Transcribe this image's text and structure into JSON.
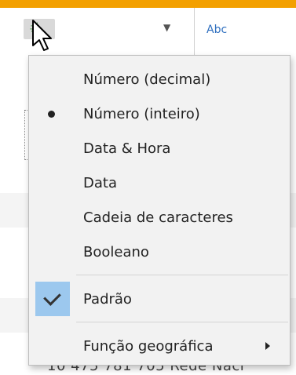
{
  "header": {
    "type_icon": "number-hash-icon",
    "dropdown_icon": "caret-down-icon",
    "next_column_type": "Abc"
  },
  "background": {
    "footer_text": "10 475 781 705   Rede Naci"
  },
  "menu": {
    "items": [
      {
        "label": "Número (decimal)"
      },
      {
        "label": "Número (inteiro)",
        "selected": true
      },
      {
        "label": "Data & Hora"
      },
      {
        "label": "Data"
      },
      {
        "label": "Cadeia de caracteres"
      },
      {
        "label": "Booleano"
      },
      {
        "label": "Padrão",
        "checked": true
      },
      {
        "label": "Função geográfica",
        "submenu": true
      }
    ]
  },
  "colors": {
    "checked_bg": "#9cc8ee",
    "menu_bg": "#f2f2f2",
    "accent_top": "#f3a000",
    "abc_blue": "#2f6fbf"
  }
}
